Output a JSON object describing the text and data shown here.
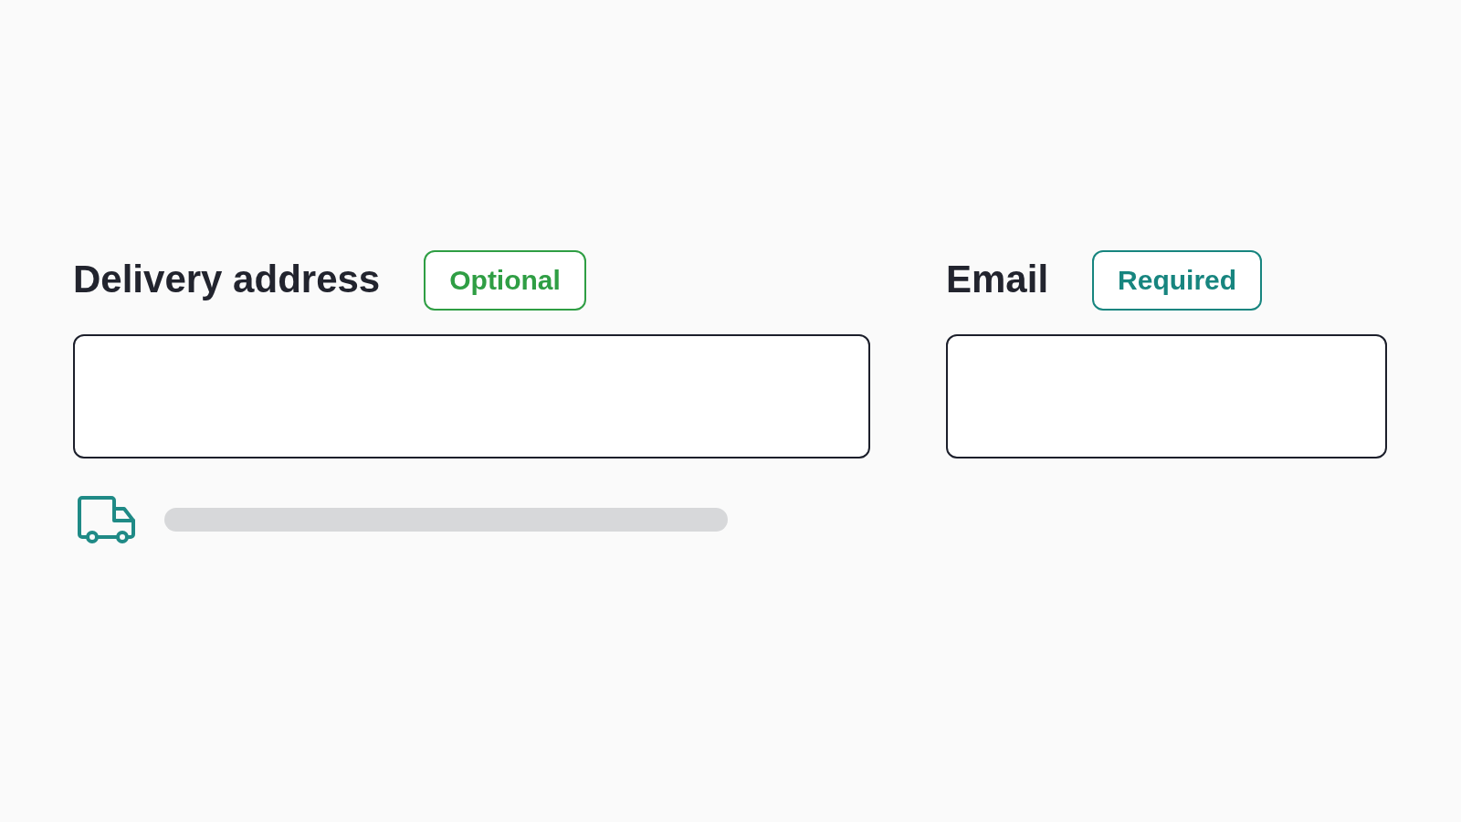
{
  "form": {
    "fields": [
      {
        "kind": "address",
        "label": "Delivery address",
        "badge": {
          "kind": "optional",
          "text": "Optional"
        }
      },
      {
        "kind": "email",
        "label": "Email",
        "badge": {
          "kind": "required",
          "text": "Required"
        }
      }
    ]
  }
}
